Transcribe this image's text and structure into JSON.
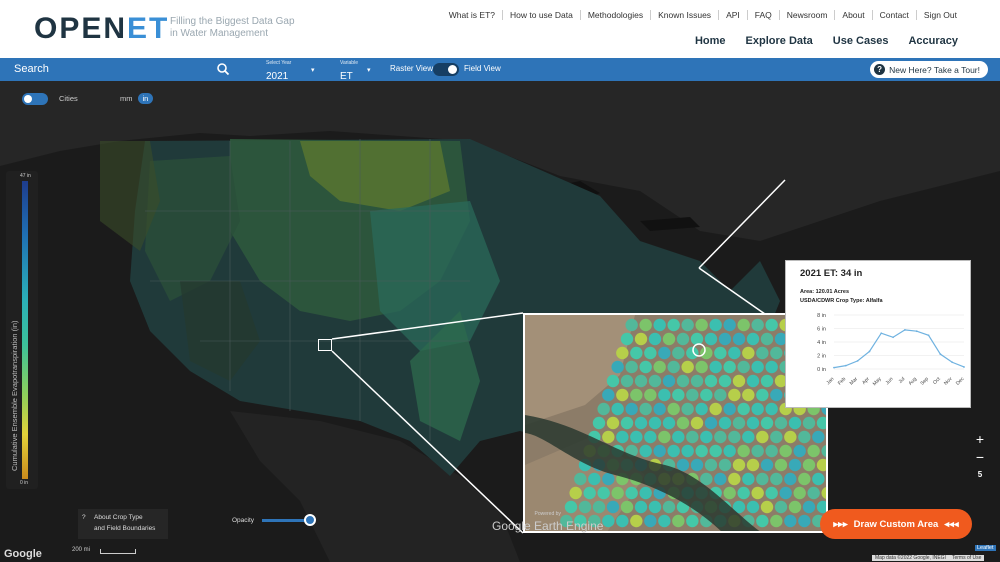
{
  "header": {
    "logo_prefix": "OPEN",
    "logo_suffix": "ET",
    "tagline_line1": "Filling the Biggest Data Gap",
    "tagline_line2": "in Water Management",
    "top_links": [
      "What is ET?",
      "How to use Data",
      "Methodologies",
      "Known Issues",
      "API",
      "FAQ",
      "Newsroom",
      "About",
      "Contact",
      "Sign Out"
    ],
    "main_nav": [
      "Home",
      "Explore Data",
      "Use Cases",
      "Accuracy"
    ]
  },
  "toolbar": {
    "search_label": "Search",
    "year_caption": "Select Year",
    "year_value": "2021",
    "variable_caption": "Variable",
    "variable_value": "ET",
    "raster_view_label": "Raster View",
    "field_view_label": "Field View",
    "tour_label": "New Here? Take a Tour!"
  },
  "map": {
    "cities_label": "Cities",
    "unit_mm": "mm",
    "unit_in": "in",
    "legend_title": "Cumulative Ensemble Evapotranspiration (in)",
    "legend_max": "47 in",
    "legend_min": "0 in",
    "zoom_in": "+",
    "zoom_out": "−",
    "zoom_level": "5",
    "crop_info_q": "?",
    "crop_info_line1": "About Crop Type",
    "crop_info_line2": "and Field Boundaries",
    "opacity_label": "Opacity",
    "opacity_value": 0.95,
    "gee_small": "Powered by",
    "gee_big": "Google Earth Engine",
    "draw_button": "Draw Custom Area",
    "google_logo": "Google",
    "scale_label": "200 mi",
    "attribution_data": "Map data ©2022 Google, INEGI",
    "attribution_terms": "Terms of Use",
    "leaflet": "Leaflet"
  },
  "popup": {
    "title": "2021 ET: 34 in",
    "area": "Area: 120.01 Acres",
    "crop": "USDA/CDWR Crop Type: Alfalfa"
  },
  "colors": {
    "brand_blue": "#2e74b8",
    "accent_orange": "#f05a1e",
    "line_blue": "#6fb2e0"
  },
  "chart_data": {
    "type": "line",
    "title": "",
    "xlabel": "",
    "ylabel": "",
    "categories": [
      "Jan",
      "Feb",
      "Mar",
      "Apr",
      "May",
      "Jun",
      "Jul",
      "Aug",
      "Sep",
      "Oct",
      "Nov",
      "Dec"
    ],
    "values": [
      0.2,
      0.5,
      1.2,
      2.6,
      5.3,
      4.7,
      5.8,
      5.6,
      5.0,
      2.2,
      1.0,
      0.3
    ],
    "yticks": [
      "0 in",
      "2 in",
      "4 in",
      "6 in",
      "8 in"
    ],
    "ylim": [
      0,
      8
    ],
    "grid": true
  }
}
